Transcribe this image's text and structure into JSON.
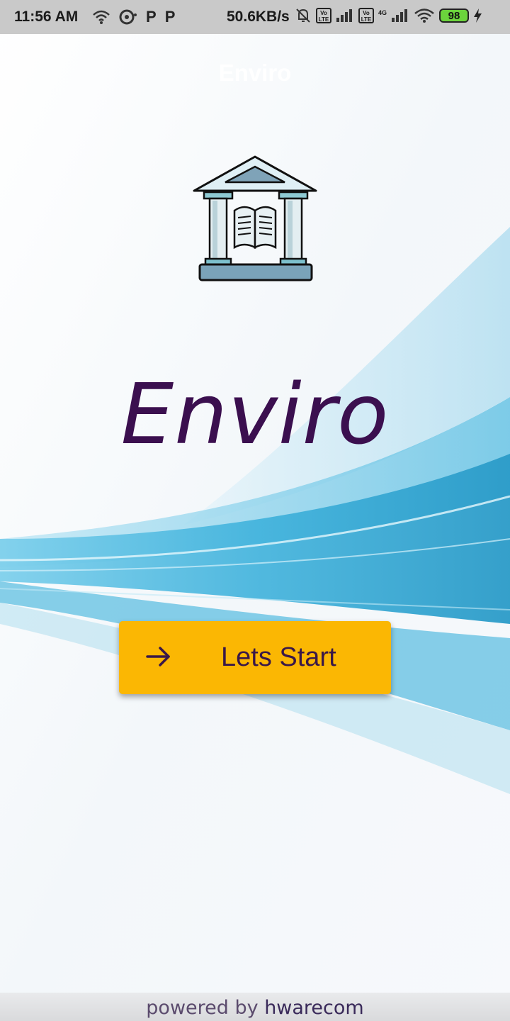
{
  "status_bar": {
    "time": "11:56 AM",
    "network_speed": "50.6KB/s",
    "battery_level": "98",
    "p_icon_1": "P",
    "p_icon_2": "P",
    "volte_1": "Vo LTE",
    "volte_2": "Vo LTE",
    "network_type": "4G"
  },
  "app_bar": {
    "title": "Enviro"
  },
  "main": {
    "logo_icon": "library-building-icon",
    "brand_name": "Enviro",
    "start_button_label": "Lets Start",
    "start_button_icon": "arrow-right-icon"
  },
  "footer": {
    "prefix": "powered by",
    "brand": "hwarecom"
  },
  "colors": {
    "brand_text": "#3b0f4f",
    "button_bg": "#fbb703",
    "button_text": "#3a1848",
    "wave_blue": "#4cb8dc"
  }
}
